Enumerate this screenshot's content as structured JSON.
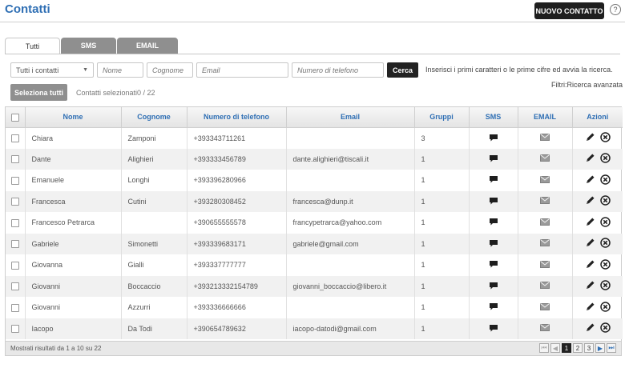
{
  "header": {
    "title": "Contatti",
    "new_contact_label": "NUOVO CONTATTO",
    "help_label": "?"
  },
  "tabs": [
    {
      "label": "Tutti",
      "active": true
    },
    {
      "label": "SMS",
      "active": false
    },
    {
      "label": "EMAIL",
      "active": false
    }
  ],
  "search": {
    "group_select_value": "Tutti i contatti",
    "name_placeholder": "Nome",
    "surname_placeholder": "Cognome",
    "email_placeholder": "Email",
    "phone_placeholder": "Numero di telefono",
    "search_button_label": "Cerca",
    "hint": "Inserisci i primi caratteri o le prime cifre ed avvia la ricerca."
  },
  "toolbar": {
    "select_all_label": "Seleziona tutti",
    "selected_count": "Contatti selezionati0 / 22",
    "filters_label": "Filtri:Ricerca avanzata"
  },
  "table": {
    "columns": [
      "Nome",
      "Cognome",
      "Numero di telefono",
      "Email",
      "Gruppi",
      "SMS",
      "EMAIL",
      "Azioni"
    ],
    "rows": [
      {
        "nome": "Chiara",
        "cognome": "Zamponi",
        "telefono": "+393343711261",
        "email": "",
        "gruppi": "3"
      },
      {
        "nome": "Dante",
        "cognome": "Alighieri",
        "telefono": "+393333456789",
        "email": "dante.alighieri@tiscali.it",
        "gruppi": "1"
      },
      {
        "nome": "Emanuele",
        "cognome": "Longhi",
        "telefono": "+393396280966",
        "email": "",
        "gruppi": "1"
      },
      {
        "nome": "Francesca",
        "cognome": "Cutini",
        "telefono": "+393280308452",
        "email": "francesca@dunp.it",
        "gruppi": "1"
      },
      {
        "nome": "Francesco Petrarca",
        "cognome": "",
        "telefono": "+390655555578",
        "email": "francypetrarca@yahoo.com",
        "gruppi": "1"
      },
      {
        "nome": "Gabriele",
        "cognome": "Simonetti",
        "telefono": "+393339683171",
        "email": "gabriele@gmail.com",
        "gruppi": "1"
      },
      {
        "nome": "Giovanna",
        "cognome": "Gialli",
        "telefono": "+393337777777",
        "email": "",
        "gruppi": "1"
      },
      {
        "nome": "Giovanni",
        "cognome": "Boccaccio",
        "telefono": "+393213332154789",
        "email": "giovanni_boccaccio@libero.it",
        "gruppi": "1"
      },
      {
        "nome": "Giovanni",
        "cognome": "Azzurri",
        "telefono": "+393336666666",
        "email": "",
        "gruppi": "1"
      },
      {
        "nome": "Iacopo",
        "cognome": "Da Todi",
        "telefono": "+390654789632",
        "email": "iacopo-datodi@gmail.com",
        "gruppi": "1"
      }
    ]
  },
  "footer": {
    "results_text": "Mostrati risultati da 1 a 10 su 22",
    "pages": [
      "1",
      "2",
      "3"
    ],
    "current_page": "1"
  },
  "colors": {
    "accent": "#2f6fb4",
    "dark_button": "#1f1f1f",
    "tab_inactive": "#8f8f8f"
  },
  "icons": {
    "sms": "speech-bubble-icon",
    "email": "envelope-icon",
    "edit": "pencil-icon",
    "delete": "close-circle-icon"
  }
}
